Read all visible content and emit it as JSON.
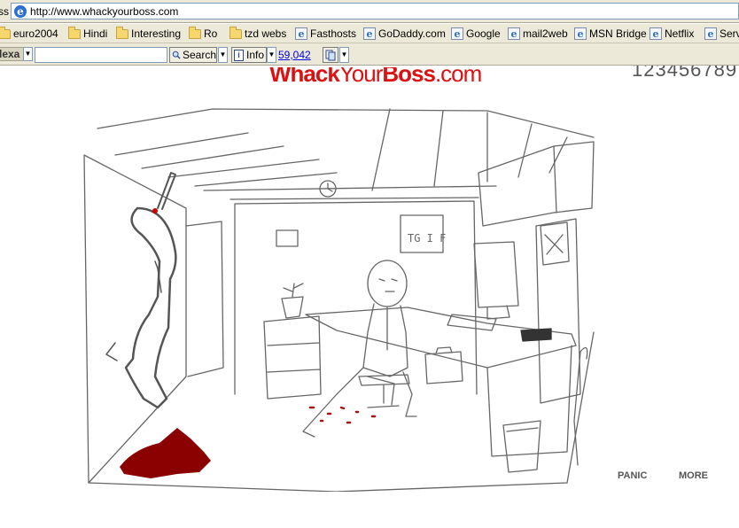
{
  "browser": {
    "address_label": "ss",
    "url": "http://www.whackyourboss.com",
    "links": [
      {
        "label": "euro2004",
        "icon": "folder-icon"
      },
      {
        "label": "Hindi",
        "icon": "folder-icon"
      },
      {
        "label": "Interesting",
        "icon": "folder-icon"
      },
      {
        "label": "Ro",
        "icon": "folder-icon"
      },
      {
        "label": "tzd webs",
        "icon": "folder-icon"
      },
      {
        "label": "Fasthosts",
        "icon": "ie-page-icon"
      },
      {
        "label": "GoDaddy.com",
        "icon": "ie-page-icon"
      },
      {
        "label": "Google",
        "icon": "ie-page-icon"
      },
      {
        "label": "mail2web",
        "icon": "ie-page-icon"
      },
      {
        "label": "MSN Bridge",
        "icon": "ie-page-icon"
      },
      {
        "label": "Netflix",
        "icon": "ie-page-icon"
      },
      {
        "label": "Serv",
        "icon": "ie-page-icon"
      }
    ]
  },
  "toolbar": {
    "brand": "lexa",
    "search_value": "",
    "search_label": "Search",
    "info_label": "Info",
    "rank": "59,042"
  },
  "page": {
    "logo_bold_1": "Whack",
    "logo_thin": "Your",
    "logo_bold_2": "Boss",
    "logo_tld": ".com",
    "counter": "123456789",
    "scene_sign": "TG I F",
    "panic_label": "PANIC",
    "more_label": "MORE"
  },
  "colors": {
    "brand_red": "#dd1111",
    "blood": "#8b0000",
    "toolbar_bg": "#ece9d8"
  }
}
